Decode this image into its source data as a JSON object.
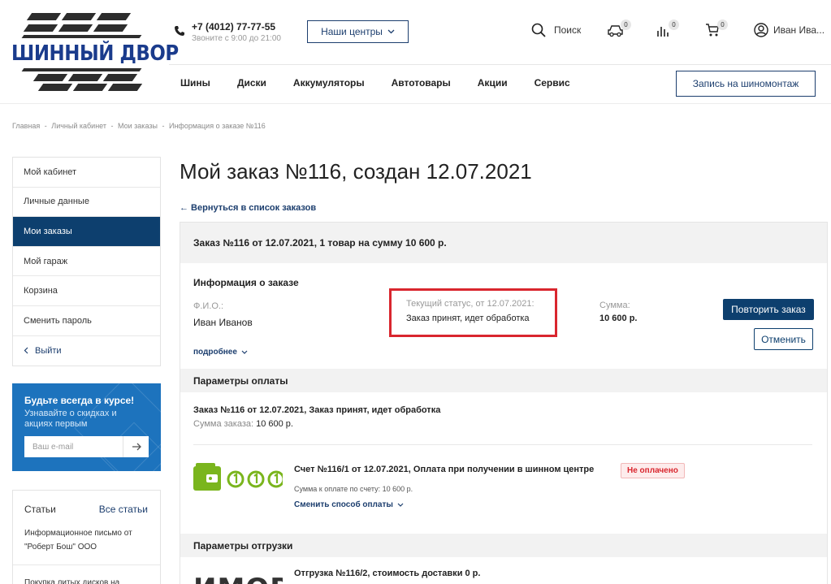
{
  "header": {
    "logo_text": "ШИННЫЙ ДВОР",
    "phone": "+7 (4012) 77-77-55",
    "phone_hours": "Звоните с 9:00 до 21:00",
    "centers_button": "Наши центры",
    "search_label": "Поиск",
    "garage_count": "0",
    "compare_count": "0",
    "cart_count": "0",
    "user_name": "Иван Ива...",
    "record_button": "Запись на шиномонтаж"
  },
  "nav": [
    "Шины",
    "Диски",
    "Аккумуляторы",
    "Автотовары",
    "Акции",
    "Сервис"
  ],
  "breadcrumb": [
    "Главная",
    "-",
    "Личный кабинет",
    "-",
    "Мои заказы",
    "-",
    "Информация о заказе №116"
  ],
  "sidebar": {
    "items": [
      {
        "label": "Мой кабинет"
      },
      {
        "label": "Личные данные"
      },
      {
        "label": "Мои заказы"
      },
      {
        "label": "Мой гараж"
      },
      {
        "label": "Корзина"
      },
      {
        "label": "Сменить пароль"
      },
      {
        "label": "Выйти"
      }
    ],
    "active_index": 2
  },
  "subscribe": {
    "title": "Будьте всегда в курсе!",
    "text": "Узнавайте о скидках и акциях первым",
    "placeholder": "Ваш e-mail"
  },
  "articles": {
    "title": "Статьи",
    "all_link": "Все статьи",
    "items": [
      "Информационное письмо от \"Роберт Бош\" ООО",
      "Покупка литых дисков на"
    ]
  },
  "page": {
    "title": "Мой заказ №116, создан 12.07.2021",
    "back_link": "← Вернуться в список заказов"
  },
  "order": {
    "summary": "Заказ №116 от 12.07.2021, 1 товар на сумму 10 600 р.",
    "info_title": "Информация о заказе",
    "fio_label": "Ф.И.О.:",
    "fio_value": "Иван Иванов",
    "status_label": "Текущий статус, от 12.07.2021:",
    "status_value": "Заказ принят, идет обработка",
    "sum_label": "Сумма:",
    "sum_value": "10 600 р.",
    "repeat_button": "Повторить заказ",
    "cancel_button": "Отменить",
    "more_link": "подробнее",
    "payment": {
      "title": "Параметры оплаты",
      "order_line": "Заказ №116 от 12.07.2021, Заказ принят, идет обработка",
      "order_sum_label": "Сумма заказа:",
      "order_sum_value": "10 600 р.",
      "invoice_title": "Счет №116/1 от 12.07.2021, Оплата при получении в шинном центре",
      "invoice_status": "Не оплачено",
      "invoice_sum": "Сумма к оплате по счету: 10 600 р.",
      "change_link": "Сменить способ оплаты"
    },
    "shipping": {
      "title": "Параметры отгрузки",
      "shipment_line": "Отгрузка №116/2, стоимость доставки 0 р.",
      "logo_text": "ИМОВ"
    }
  },
  "colors": {
    "primary": "#0d3f6e",
    "accent_blue": "#1d73bd",
    "highlight_red": "#d9262e",
    "pay_green": "#7ab51d"
  }
}
